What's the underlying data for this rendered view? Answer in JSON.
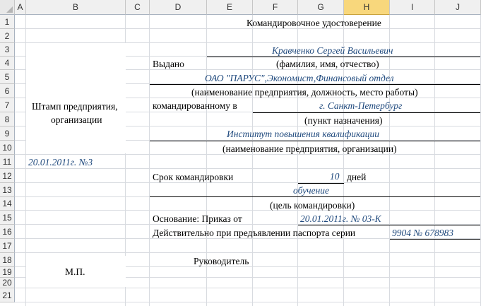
{
  "columns": [
    "A",
    "B",
    "C",
    "D",
    "E",
    "F",
    "G",
    "H",
    "I",
    "J"
  ],
  "selected_column": "H",
  "rows": [
    "1",
    "2",
    "3",
    "4",
    "5",
    "6",
    "7",
    "8",
    "9",
    "10",
    "11",
    "12",
    "13",
    "14",
    "15",
    "16",
    "17",
    "18",
    "19",
    "20",
    "21"
  ],
  "doc": {
    "title": "Командировочное удостоверение",
    "issued_label": "Выдано",
    "name": "Кравченко Сергей Васильевич",
    "name_caption": "(фамилия, имя, отчество)",
    "org_position": "ОАО \"ПАРУС\",Экономист,Финансовый отдел",
    "org_caption": "(наименование предприятия, должность, место работы)",
    "stamp_line1": "Штамп предприятия,",
    "stamp_line2": "организации",
    "sent_to_label": "командированному в",
    "destination": "г. Санкт-Петербург",
    "destination_caption": "(пункт назначения)",
    "institution": "Институт повышения квалификации",
    "institution_caption": "(наименование предприятия, организации)",
    "reg_date": "20.01.2011г. №3",
    "term_label": "Срок командировки",
    "term_days": "10",
    "days_label": "дней",
    "purpose": "обучение",
    "purpose_caption": "(цель командировки)",
    "basis_label": "Основание: Приказ от",
    "basis_value": "20.01.2011г. № 03-К",
    "passport_label": "Действительно при предъявлении паспорта серии",
    "passport_value": "9904 № 678983",
    "seal": "М.П.",
    "head_label": "Руководитель"
  }
}
